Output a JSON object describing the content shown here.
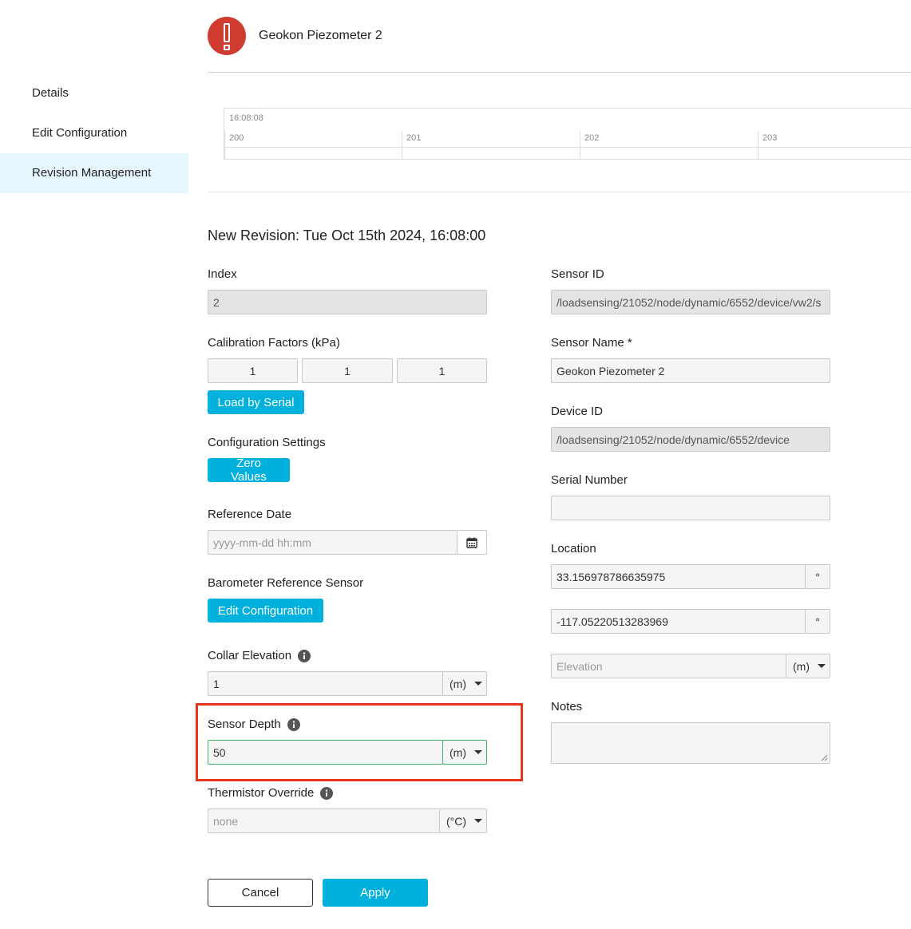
{
  "sidebar": {
    "items": [
      {
        "label": "Details"
      },
      {
        "label": "Edit Configuration"
      },
      {
        "label": "Revision Management"
      }
    ]
  },
  "header": {
    "title": "Geokon Piezometer 2"
  },
  "timeline": {
    "time": "16:08:08",
    "ticks": [
      "200",
      "201",
      "202",
      "203"
    ]
  },
  "revision": {
    "title": "New Revision: Tue Oct 15th 2024, 16:08:00"
  },
  "left": {
    "index": {
      "label": "Index",
      "value": "2"
    },
    "calibration": {
      "label": "Calibration Factors (kPa)",
      "values": [
        "1",
        "1",
        "1"
      ],
      "button": "Load by Serial"
    },
    "config": {
      "label": "Configuration Settings",
      "button": "Zero Values"
    },
    "reference_date": {
      "label": "Reference Date",
      "placeholder": "yyyy-mm-dd hh:mm"
    },
    "barometer": {
      "label": "Barometer Reference Sensor",
      "button": "Edit Configuration"
    },
    "collar": {
      "label": "Collar Elevation",
      "value": "1",
      "unit": "(m)"
    },
    "depth": {
      "label": "Sensor Depth",
      "value": "50",
      "unit": "(m)"
    },
    "thermistor": {
      "label": "Thermistor Override",
      "placeholder": "none",
      "unit": "(°C)"
    }
  },
  "right": {
    "sensor_id": {
      "label": "Sensor ID",
      "value": "/loadsensing/21052/node/dynamic/6552/device/vw2/s"
    },
    "sensor_name": {
      "label": "Sensor Name *",
      "value": "Geokon Piezometer 2"
    },
    "device_id": {
      "label": "Device ID",
      "value": "/loadsensing/21052/node/dynamic/6552/device"
    },
    "serial": {
      "label": "Serial Number",
      "value": ""
    },
    "location": {
      "label": "Location",
      "lat": "33.156978786635975",
      "lon": "-117.05220513283969",
      "deg": "°",
      "elevation_placeholder": "Elevation",
      "elevation_unit": "(m)"
    },
    "notes": {
      "label": "Notes"
    }
  },
  "actions": {
    "cancel": "Cancel",
    "apply": "Apply"
  },
  "colors": {
    "accent": "#00b0dd",
    "alert": "#cf3b2f",
    "highlight": "#e8361a",
    "active_bg": "#e5f7fc",
    "valid": "#45b16b"
  }
}
